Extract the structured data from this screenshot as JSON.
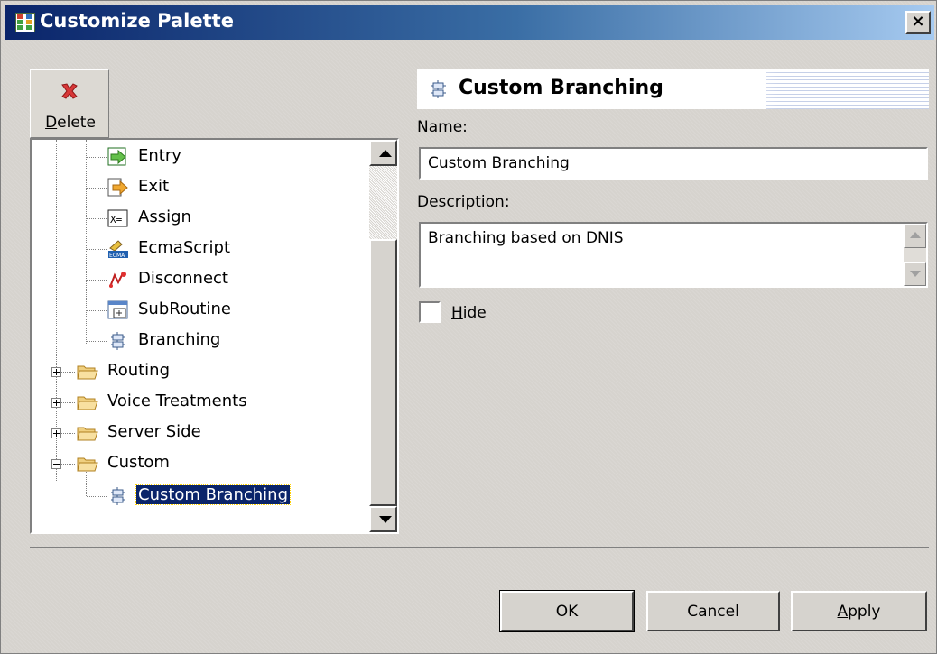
{
  "window": {
    "title": "Customize Palette",
    "close_label": "×"
  },
  "toolbar": {
    "delete_label": "Delete"
  },
  "tree": {
    "items": [
      {
        "label": "Entry",
        "icon": "entry-icon"
      },
      {
        "label": "Exit",
        "icon": "exit-icon"
      },
      {
        "label": "Assign",
        "icon": "assign-icon"
      },
      {
        "label": "EcmaScript",
        "icon": "ecmascript-icon"
      },
      {
        "label": "Disconnect",
        "icon": "disconnect-icon"
      },
      {
        "label": "SubRoutine",
        "icon": "subroutine-icon"
      },
      {
        "label": "Branching",
        "icon": "branching-icon"
      },
      {
        "label": "Routing",
        "icon": "folder-icon",
        "state": "collapsed"
      },
      {
        "label": "Voice Treatments",
        "icon": "folder-icon",
        "state": "collapsed"
      },
      {
        "label": "Server Side",
        "icon": "folder-icon",
        "state": "collapsed"
      },
      {
        "label": "Custom",
        "icon": "folder-icon",
        "state": "expanded"
      },
      {
        "label": "Custom Branching",
        "icon": "branching-icon",
        "selected": true
      }
    ]
  },
  "details": {
    "header_title": "Custom Branching",
    "name_label": "Name:",
    "name_value": "Custom Branching",
    "description_label": "Description:",
    "description_value": "Branching based on DNIS",
    "hide_label": "Hide",
    "hide_checked": false
  },
  "buttons": {
    "ok": "OK",
    "cancel": "Cancel",
    "apply": "Apply"
  },
  "colors": {
    "title_bar": "#0a246a",
    "selection": "#0a246a",
    "dialog_bg": "#d6d3ce"
  }
}
